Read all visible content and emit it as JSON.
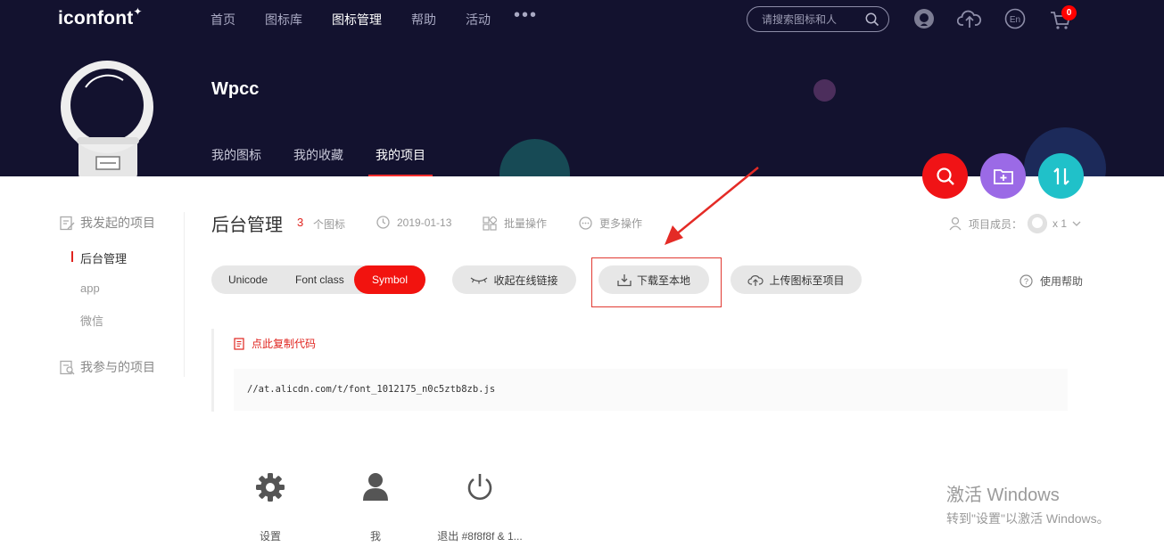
{
  "header": {
    "logo": "iconfont",
    "logo_star": "✦",
    "nav": [
      "首页",
      "图标库",
      "图标管理",
      "帮助",
      "活动"
    ],
    "nav_active_index": 2,
    "more": "•••",
    "search_placeholder": "请搜索图标和人",
    "cart_count": "0"
  },
  "profile": {
    "username": "Wpcc",
    "tabs": [
      "我的图标",
      "我的收藏",
      "我的项目"
    ],
    "active_tab_index": 2
  },
  "sidebar": {
    "my_projects_heading": "我发起的项目",
    "projects": [
      "后台管理",
      "app",
      "微信"
    ],
    "active_project_index": 0,
    "joined_heading": "我参与的项目"
  },
  "project": {
    "title": "后台管理",
    "icon_count": "3",
    "icon_count_label": "个图标",
    "date": "2019-01-13",
    "batch": "批量操作",
    "more": "更多操作",
    "members_label": "项目成员：",
    "members_count": "x 1"
  },
  "toolbar": {
    "seg_unicode": "Unicode",
    "seg_fontclass": "Font class",
    "seg_symbol": "Symbol",
    "collapse_link": "收起在线链接",
    "download": "下载至本地",
    "upload": "上传图标至项目",
    "help": "使用帮助"
  },
  "code": {
    "copy_label": "点此复制代码",
    "url": "//at.alicdn.com/t/font_1012175_n0c5ztb8zb.js"
  },
  "bottom": [
    {
      "label": "设置",
      "icon": "gear-icon"
    },
    {
      "label": "我",
      "icon": "user-icon"
    },
    {
      "label": "退出 #8f8f8f & 1...",
      "icon": "power-icon"
    }
  ],
  "watermark": {
    "line1": "激活 Windows",
    "line2": "转到\"设置\"以激活 Windows。"
  },
  "colors": {
    "header_bg": "#13122f",
    "accent_red": "#f2130f",
    "fab_purple": "#9b6ae6",
    "fab_teal": "#20c1c9"
  }
}
